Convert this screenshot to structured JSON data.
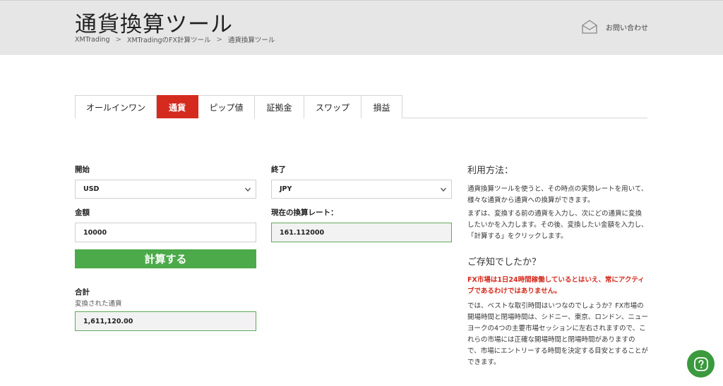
{
  "header": {
    "title": "通貨換算ツール",
    "breadcrumb": [
      "XMTrading",
      "XMTradingのFX計算ツール",
      "通貨換算ツール"
    ],
    "contact_label": "お問い合わせ"
  },
  "tabs": [
    {
      "label": "オールインワン",
      "active": false
    },
    {
      "label": "通貨",
      "active": true
    },
    {
      "label": "ピップ値",
      "active": false
    },
    {
      "label": "証拠金",
      "active": false
    },
    {
      "label": "スワップ",
      "active": false
    },
    {
      "label": "損益",
      "active": false
    }
  ],
  "form": {
    "from_label": "開始",
    "from_value": "USD",
    "to_label": "終了",
    "to_value": "JPY",
    "amount_label": "金額",
    "amount_value": "10000",
    "rate_label": "現在の換算レート：",
    "rate_value": "161.112000",
    "calc_button": "計算する",
    "total_label": "合計",
    "total_sublabel": "変換された通貨",
    "total_value": "1,611,120.00"
  },
  "sidebar": {
    "howto_title": "利用方法：",
    "howto_p1": "通貨換算ツールを使うと、その時点の実勢レートを用いて、様々な通貨から通貨への換算ができます。",
    "howto_p2": "まずは、変換する前の通貨を入力し、次にどの通貨に変換したいかを入力します。その後、変換したい金額を入力し、「計算する」をクリックします。",
    "didyouknow_title": "ご存知でしたか？",
    "didyouknow_red": "FX市場は1日24時間稼働しているとはいえ、常にアクティブであるわけではありません。",
    "didyouknow_p": "では、ベストな取引時間はいつなのでしょうか？FX市場の開場時間と閉場時間は、シドニー、東京、ロンドン、ニューヨークの4つの主要市場セッションに左右されますので、これらの市場には正確な開場時間と閉場時間がありますので、市場にエントリーする時間を決定する目安とすることができます。"
  },
  "colors": {
    "accent_red": "#d52b1e",
    "accent_green": "#4caa4a"
  }
}
